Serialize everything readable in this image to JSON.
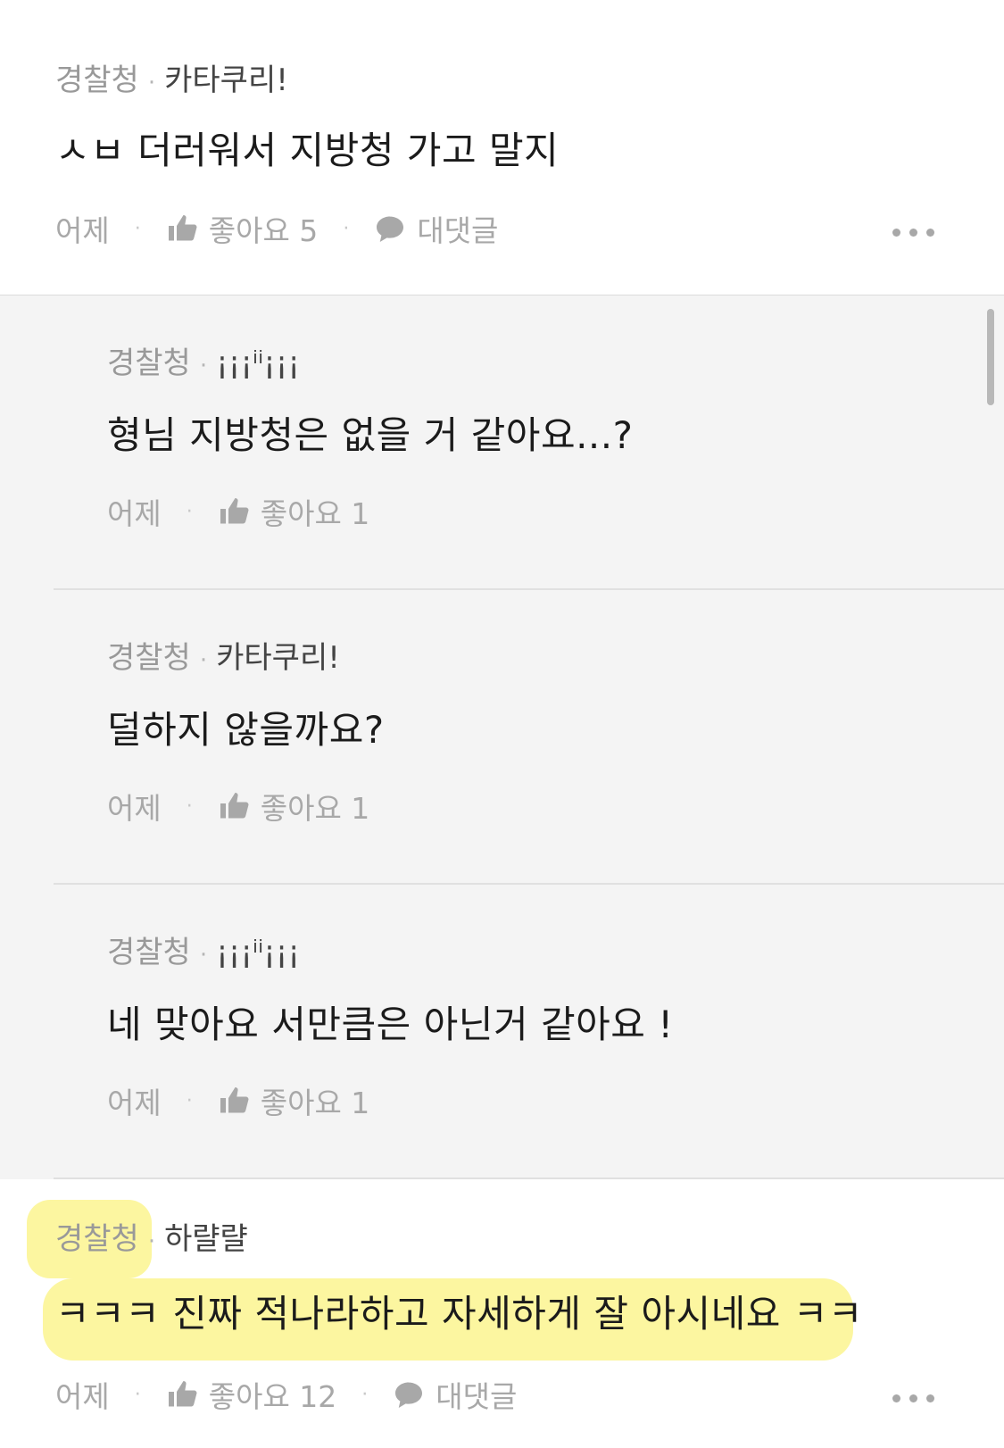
{
  "comments": [
    {
      "group": "경찰청",
      "nickname": "카타쿠리!",
      "text": "ㅅㅂ 더러워서 지방청 가고 말지",
      "time": "어제",
      "like_label": "좋아요 5",
      "reply_label": "대댓글"
    },
    {
      "group": "경찰청",
      "nickname": "하랼랼",
      "text": "ㅋㅋㅋ 진짜 적나라하고 자세하게 잘 아시네요 ㅋㅋ",
      "time": "어제",
      "like_label": "좋아요 12",
      "reply_label": "대댓글"
    }
  ],
  "replies": [
    {
      "group": "경찰청",
      "nickname": "¡¡¡ⁱⁱ¡¡¡",
      "text": "형님 지방청은 없을 거 같아요...?",
      "time": "어제",
      "like_label": "좋아요 1"
    },
    {
      "group": "경찰청",
      "nickname": "카타쿠리!",
      "text": "덜하지 않을까요?",
      "time": "어제",
      "like_label": "좋아요 1"
    },
    {
      "group": "경찰청",
      "nickname": "¡¡¡ⁱⁱ¡¡¡",
      "text": "네 맞아요 서만큼은 아닌거 같아요 !",
      "time": "어제",
      "like_label": "좋아요 1"
    }
  ],
  "icons": {
    "like": "thumbs-up-icon",
    "reply": "speech-bubble-icon",
    "more": "more-dots-icon"
  },
  "colors": {
    "highlight": "#fbf48f",
    "reply_background": "#f4f4f4"
  }
}
